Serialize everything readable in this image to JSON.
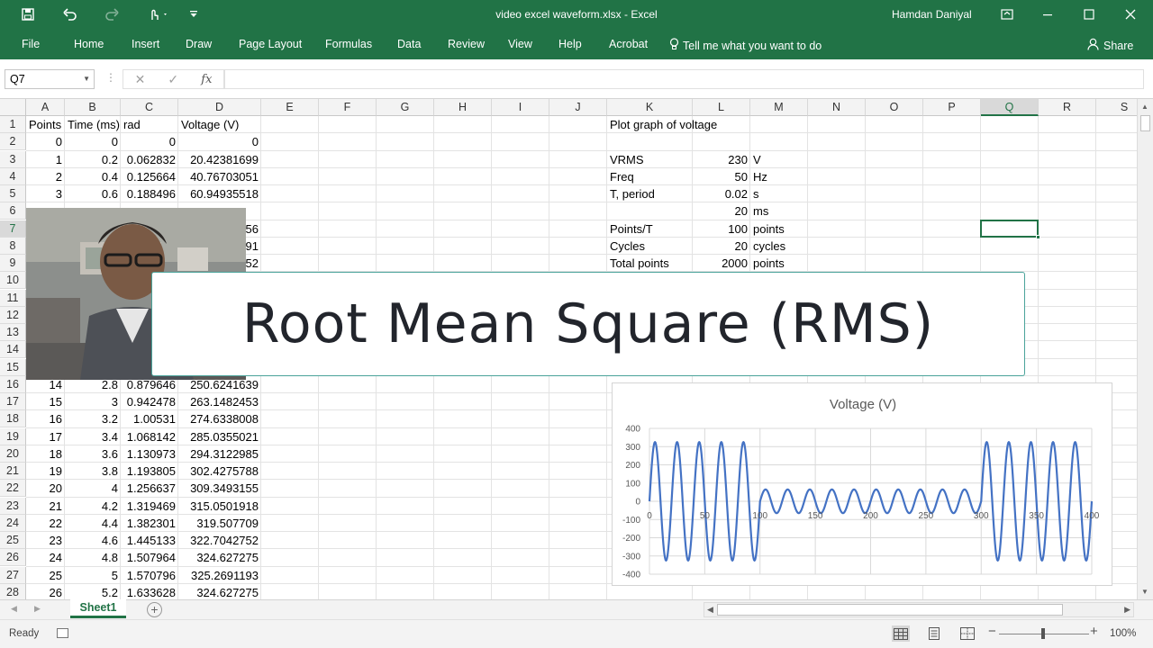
{
  "window": {
    "title": "video excel waveform.xlsx  -  Excel",
    "user": "Hamdan Daniyal"
  },
  "ribbon": {
    "tabs": [
      "File",
      "Home",
      "Insert",
      "Draw",
      "Page Layout",
      "Formulas",
      "Data",
      "Review",
      "View",
      "Help",
      "Acrobat"
    ],
    "tell_me": "Tell me what you want to do",
    "share": "Share"
  },
  "formula_bar": {
    "name_box": "Q7",
    "fx": "fx",
    "formula": ""
  },
  "columns": [
    "A",
    "B",
    "C",
    "D",
    "E",
    "F",
    "G",
    "H",
    "I",
    "J",
    "K",
    "L",
    "M",
    "N",
    "O",
    "P",
    "Q",
    "R",
    "S"
  ],
  "rows": [
    "1",
    "2",
    "3",
    "4",
    "5",
    "6",
    "7",
    "8",
    "9",
    "10",
    "11",
    "12",
    "13",
    "14",
    "15",
    "16",
    "17",
    "18",
    "19",
    "20",
    "21",
    "22",
    "23",
    "24",
    "25",
    "26",
    "27",
    "28"
  ],
  "selected": {
    "column": "Q",
    "row": "7"
  },
  "headers": {
    "a": "Points",
    "b": "Time (ms)",
    "c": "rad",
    "d": "Voltage (V)"
  },
  "table_rows": [
    [
      "0",
      "0",
      "0",
      "0"
    ],
    [
      "1",
      "0.2",
      "0.062832",
      "20.42381699"
    ],
    [
      "2",
      "0.4",
      "0.125664",
      "40.76703051"
    ],
    [
      "3",
      "0.6",
      "0.188496",
      "60.94935518"
    ],
    [
      "14",
      "2.8",
      "0.879646",
      "250.6241639"
    ],
    [
      "15",
      "3",
      "0.942478",
      "263.1482453"
    ],
    [
      "16",
      "3.2",
      "1.00531",
      "274.6338008"
    ],
    [
      "17",
      "3.4",
      "1.068142",
      "285.0355021"
    ],
    [
      "18",
      "3.6",
      "1.130973",
      "294.3122985"
    ],
    [
      "19",
      "3.8",
      "1.193805",
      "302.4275788"
    ],
    [
      "20",
      "4",
      "1.256637",
      "309.3493155"
    ],
    [
      "21",
      "4.2",
      "1.319469",
      "315.0501918"
    ],
    [
      "22",
      "4.4",
      "1.382301",
      "319.507709"
    ],
    [
      "23",
      "4.6",
      "1.445133",
      "322.7042752"
    ],
    [
      "24",
      "4.8",
      "1.507964",
      "324.627275"
    ],
    [
      "25",
      "5",
      "1.570796",
      "325.2691193"
    ],
    [
      "26",
      "5.2",
      "1.633628",
      "324.627275"
    ]
  ],
  "partial_d": [
    "56",
    "91",
    "52"
  ],
  "params": {
    "title": "Plot graph of voltage",
    "rows": [
      [
        "VRMS",
        "230",
        "V"
      ],
      [
        "Freq",
        "50",
        "Hz"
      ],
      [
        "T, period",
        "0.02",
        "s"
      ],
      [
        "",
        "20",
        "ms"
      ],
      [
        "Points/T",
        "100",
        "points"
      ],
      [
        "Cycles",
        "20",
        "cycles"
      ],
      [
        "Total points",
        "2000",
        "points"
      ]
    ]
  },
  "banner": {
    "text": "Root Mean Square (RMS)"
  },
  "sheet": {
    "tab": "Sheet1"
  },
  "status": {
    "ready": "Ready",
    "zoom": "100%"
  },
  "chart_data": {
    "type": "line",
    "title": "Voltage (V)",
    "xlim": [
      0,
      400
    ],
    "ylim": [
      -400,
      400
    ],
    "x_ticks": [
      "0",
      "50",
      "100",
      "150",
      "200",
      "250",
      "300",
      "350",
      "400"
    ],
    "y_ticks": [
      "400",
      "300",
      "200",
      "100",
      "0",
      "-100",
      "-200",
      "-300",
      "-400"
    ],
    "grid": true,
    "color": "#4472C4",
    "segments": [
      {
        "x_range": [
          0,
          100
        ],
        "amplitude": 325.27,
        "points_per_cycle": 20
      },
      {
        "x_range": [
          100,
          300
        ],
        "amplitude": 65,
        "points_per_cycle": 20
      },
      {
        "x_range": [
          300,
          400
        ],
        "amplitude": 325.27,
        "points_per_cycle": 20
      }
    ]
  }
}
